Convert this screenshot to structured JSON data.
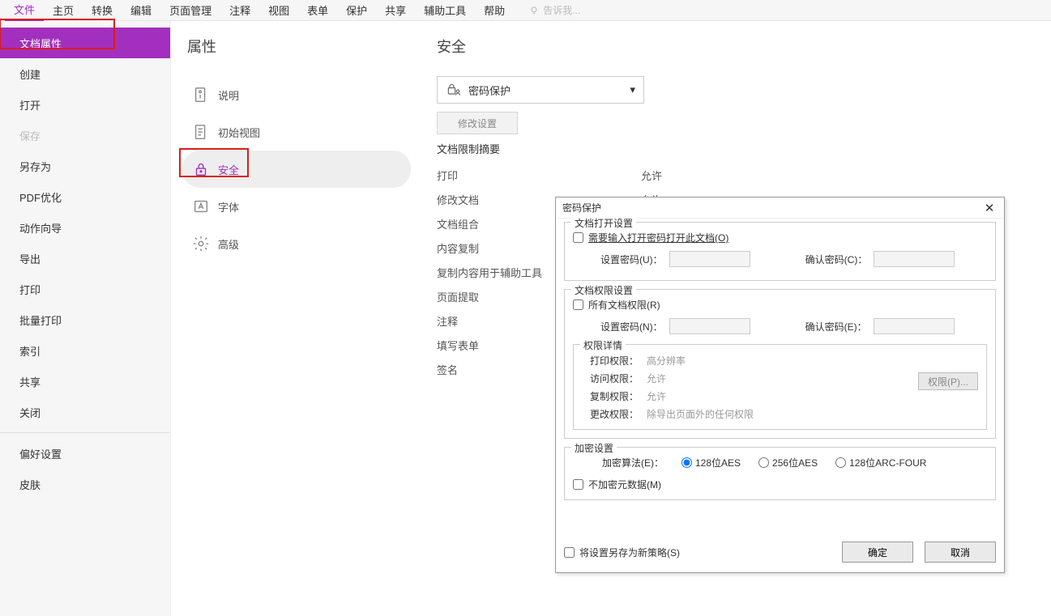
{
  "ribbon": {
    "tabs": [
      "文件",
      "主页",
      "转换",
      "编辑",
      "页面管理",
      "注释",
      "视图",
      "表单",
      "保护",
      "共享",
      "辅助工具",
      "帮助"
    ],
    "active": 0,
    "search_placeholder": "告诉我..."
  },
  "file_menu": {
    "items": [
      {
        "label": "文档属性",
        "active": true
      },
      {
        "label": "创建"
      },
      {
        "label": "打开"
      },
      {
        "label": "保存",
        "disabled": true
      },
      {
        "label": "另存为"
      },
      {
        "label": "PDF优化"
      },
      {
        "label": "动作向导"
      },
      {
        "label": "导出"
      },
      {
        "label": "打印"
      },
      {
        "label": "批量打印"
      },
      {
        "label": "索引"
      },
      {
        "label": "共享"
      },
      {
        "label": "关闭"
      }
    ],
    "bottom_items": [
      {
        "label": "偏好设置"
      },
      {
        "label": "皮肤"
      }
    ]
  },
  "properties": {
    "title": "属性",
    "items": [
      {
        "icon": "info",
        "label": "说明"
      },
      {
        "icon": "view",
        "label": "初始视图"
      },
      {
        "icon": "lock",
        "label": "安全",
        "active": true
      },
      {
        "icon": "font",
        "label": "字体"
      },
      {
        "icon": "gear",
        "label": "高级"
      }
    ]
  },
  "security": {
    "title": "安全",
    "select_label": "密码保护",
    "modify_btn": "修改设置",
    "summary_title": "文档限制摘要",
    "rows": [
      {
        "k": "打印",
        "v": "允许"
      },
      {
        "k": "修改文档",
        "v": "允许"
      },
      {
        "k": "文档组合",
        "v": ""
      },
      {
        "k": "内容复制",
        "v": ""
      },
      {
        "k": "复制内容用于辅助工具",
        "v": ""
      },
      {
        "k": "页面提取",
        "v": ""
      },
      {
        "k": "注释",
        "v": ""
      },
      {
        "k": "填写表单",
        "v": ""
      },
      {
        "k": "签名",
        "v": ""
      }
    ]
  },
  "dialog": {
    "title": "密码保护",
    "open_settings": {
      "legend": "文档打开设置",
      "chk": "需要输入打开密码打开此文档(O)",
      "pw_lbl": "设置密码(U)：",
      "confirm_lbl": "确认密码(C)："
    },
    "perm_settings": {
      "legend": "文档权限设置",
      "chk": "所有文档权限(R)",
      "pw_lbl": "设置密码(N)：",
      "confirm_lbl": "确认密码(E)：",
      "detail_legend": "权限详情",
      "rows": [
        {
          "k": "打印权限：",
          "v": "高分辨率"
        },
        {
          "k": "访问权限：",
          "v": "允许"
        },
        {
          "k": "复制权限：",
          "v": "允许"
        },
        {
          "k": "更改权限：",
          "v": "除导出页面外的任何权限"
        }
      ],
      "perm_btn": "权限(P)..."
    },
    "enc": {
      "legend": "加密设置",
      "algo_lbl": "加密算法(E)：",
      "opts": [
        "128位AES",
        "256位AES",
        "128位ARC-FOUR"
      ],
      "selected": 0,
      "nometa": "不加密元数据(M)"
    },
    "save_policy": "将设置另存为新策略(S)",
    "ok": "确定",
    "cancel": "取消"
  }
}
